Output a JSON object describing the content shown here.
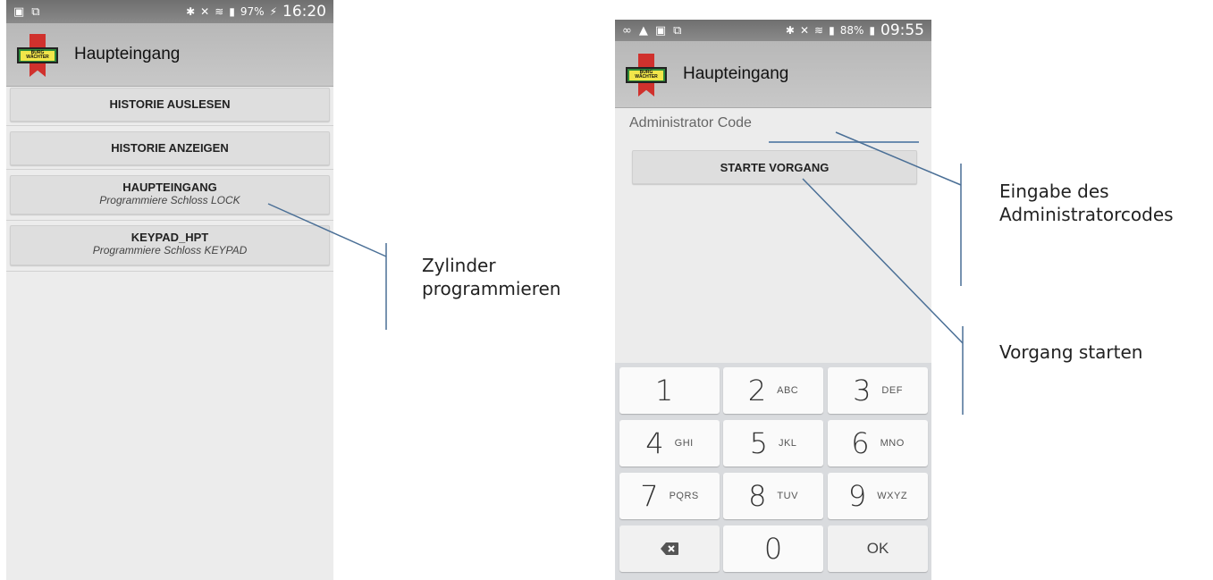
{
  "screen_left": {
    "status_time": "16:20",
    "battery": "97%",
    "app_title": "Haupteingang",
    "logo_text": [
      "BURG",
      "WÄCHTER"
    ],
    "buttons": [
      {
        "label": "HISTORIE AUSLESEN",
        "sub": ""
      },
      {
        "label": "HISTORIE ANZEIGEN",
        "sub": ""
      },
      {
        "label": "HAUPTEINGANG",
        "sub": "Programmiere Schloss LOCK"
      },
      {
        "label": "KEYPAD_HPT",
        "sub": "Programmiere Schloss KEYPAD"
      }
    ]
  },
  "screen_right": {
    "status_time": "09:55",
    "battery": "88%",
    "app_title": "Haupteingang",
    "logo_text": [
      "BURG",
      "WÄCHTER"
    ],
    "code_label": "Administrator Code",
    "code_value": "",
    "start_button": "STARTE VORGANG",
    "keypad": {
      "keys": [
        {
          "num": "1",
          "letters": ""
        },
        {
          "num": "2",
          "letters": "ABC"
        },
        {
          "num": "3",
          "letters": "DEF"
        },
        {
          "num": "4",
          "letters": "GHI"
        },
        {
          "num": "5",
          "letters": "JKL"
        },
        {
          "num": "6",
          "letters": "MNO"
        },
        {
          "num": "7",
          "letters": "PQRS"
        },
        {
          "num": "8",
          "letters": "TUV"
        },
        {
          "num": "9",
          "letters": "WXYZ"
        }
      ],
      "zero": "0",
      "ok": "OK",
      "backspace_icon": "backspace-icon"
    }
  },
  "annotations": {
    "zylinder": [
      "Zylinder",
      "programmieren"
    ],
    "eingabe": [
      "Eingabe des",
      "Administratorcodes"
    ],
    "vorgang": "Vorgang starten"
  },
  "colors": {
    "callout_line": "#4a6f96",
    "status_bar": "#7a7a7a",
    "app_bar": "#c0c0c0",
    "logo_red": "#d0312d",
    "logo_green": "#2f8a3a",
    "logo_yellow": "#f2e64a"
  }
}
